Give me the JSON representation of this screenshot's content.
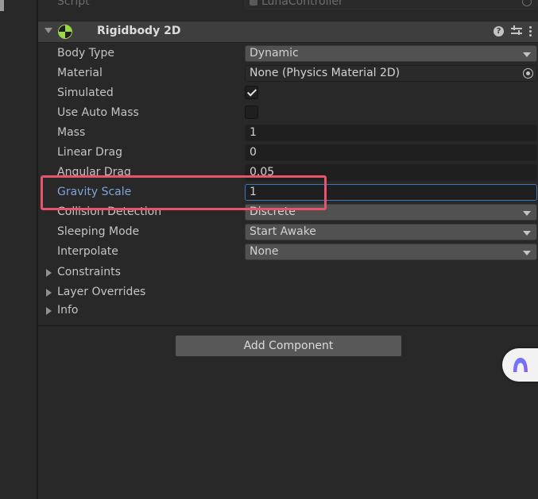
{
  "script_row": {
    "label": "Script",
    "value": "LunaController"
  },
  "component": {
    "title": "Rigidbody 2D"
  },
  "properties": {
    "body_type": {
      "label": "Body Type",
      "value": "Dynamic"
    },
    "material": {
      "label": "Material",
      "value": "None (Physics Material 2D)"
    },
    "simulated": {
      "label": "Simulated",
      "checked": true
    },
    "use_auto_mass": {
      "label": "Use Auto Mass",
      "checked": false
    },
    "mass": {
      "label": "Mass",
      "value": "1"
    },
    "linear_drag": {
      "label": "Linear Drag",
      "value": "0"
    },
    "angular_drag": {
      "label": "Angular Drag",
      "value": "0.05"
    },
    "gravity_scale": {
      "label": "Gravity Scale",
      "value": "1"
    },
    "collision_detection": {
      "label": "Collision Detection",
      "value": "Discrete"
    },
    "sleeping_mode": {
      "label": "Sleeping Mode",
      "value": "Start Awake"
    },
    "interpolate": {
      "label": "Interpolate",
      "value": "None"
    }
  },
  "foldouts": {
    "constraints": "Constraints",
    "layer_overrides": "Layer Overrides",
    "info": "Info"
  },
  "add_component_label": "Add Component",
  "colors": {
    "highlight": "#e8546a",
    "focus_label": "#7ea4d8",
    "rigidbody_icon": "#9bd84a"
  }
}
